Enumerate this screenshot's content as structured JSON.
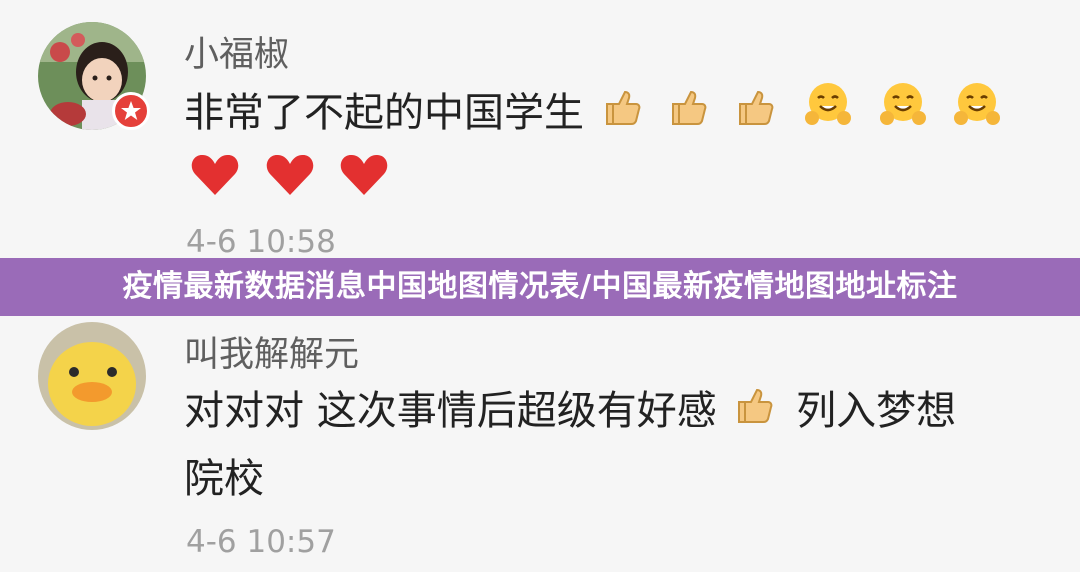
{
  "banner": {
    "title": "疫情最新数据消息中国地图情况表/中国最新疫情地图地址标注"
  },
  "comments": [
    {
      "username": "小福椒",
      "text_line1": "非常了不起的中国学生",
      "time": "4-6 10:58",
      "emojis_line1": [
        "thumbs-up",
        "thumbs-up",
        "thumbs-up",
        "hugging-face",
        "hugging-face",
        "hugging-face"
      ],
      "emojis_line2": [
        "red-heart",
        "red-heart",
        "red-heart"
      ],
      "verified_badge": true
    },
    {
      "username": "叫我解解元",
      "text_part1": "对对对 这次事情后超级有好感",
      "text_part2": "列入梦想",
      "text_line2": "院校",
      "time": "4-6 10:57",
      "emojis_inline": [
        "thumbs-up"
      ]
    }
  ],
  "colors": {
    "banner_bg": "#9a6bb8",
    "background": "#f6f6f6",
    "username": "#5f5f5f",
    "time": "#a0a0a0",
    "badge": "#e5403a"
  }
}
